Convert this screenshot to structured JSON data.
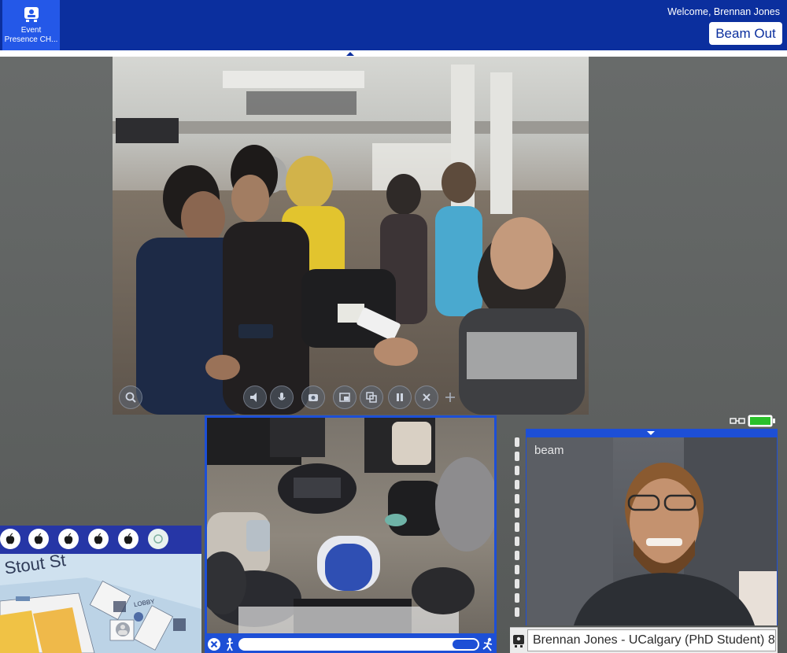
{
  "header": {
    "app_label_line1": "Event",
    "app_label_line2": "Presence CH...",
    "welcome_text": "Welcome, Brennan Jones",
    "beam_out_label": "Beam Out"
  },
  "main_video": {
    "controls": [
      "search-icon",
      "speaker-icon",
      "microphone-icon",
      "camera-icon",
      "picture-in-picture-icon",
      "layers-icon",
      "pause-icon",
      "mute-icon",
      "move-icon"
    ]
  },
  "map": {
    "street_label": "Stout St",
    "lobby_label": "LOBBY",
    "toolbar_icons": [
      "apple-icon",
      "apple-icon",
      "apple-icon",
      "apple-icon",
      "apple-icon",
      "location-pin-icon"
    ]
  },
  "self_view": {
    "watermark": "beam",
    "participant_name": "Brennan Jones - UCalgary (PhD Student) 8"
  },
  "colors": {
    "header_blue": "#0b2f9e",
    "accent_blue": "#1d4fd6",
    "battery_green": "#2ac02a"
  }
}
